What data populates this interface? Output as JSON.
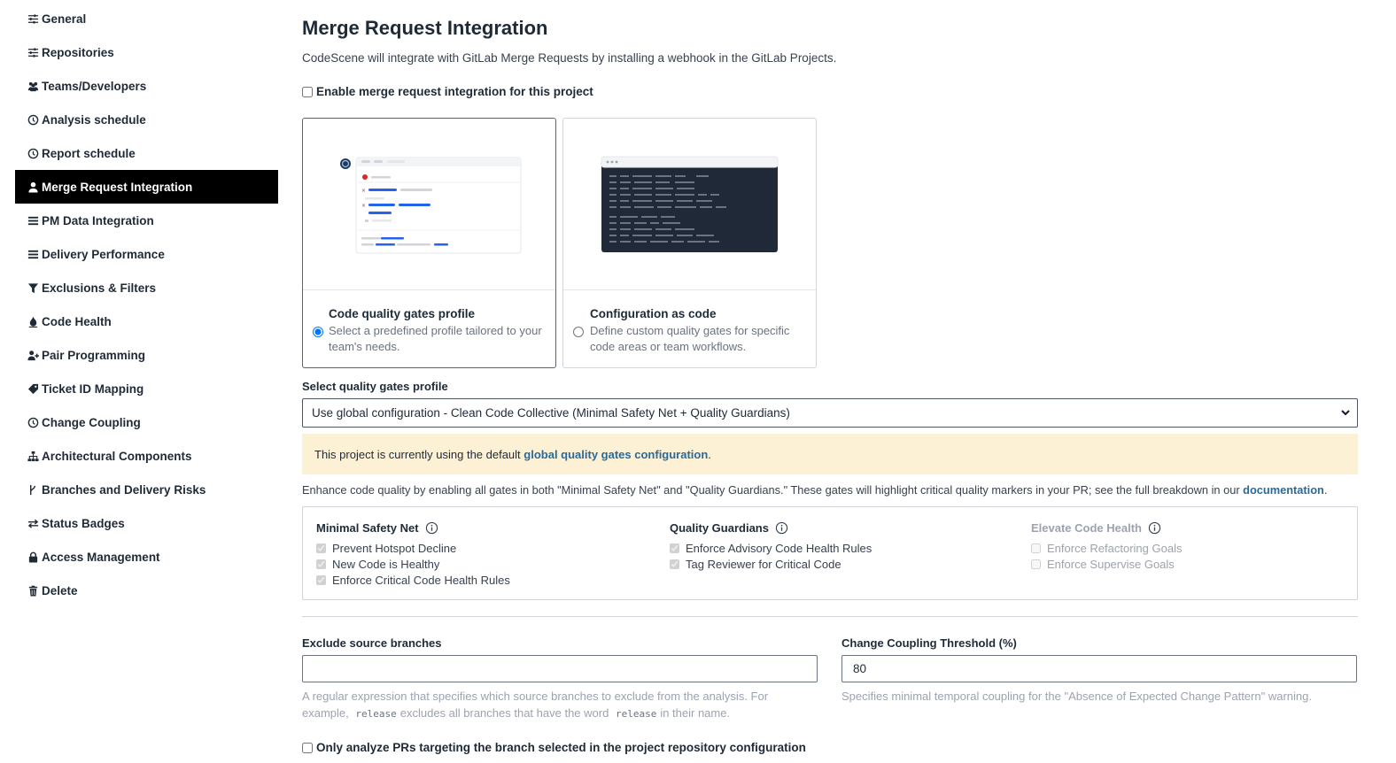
{
  "sidebar": {
    "items": [
      {
        "label": "General",
        "icon": "sliders-icon",
        "active": false
      },
      {
        "label": "Repositories",
        "icon": "sliders-icon",
        "active": false
      },
      {
        "label": "Teams/Developers",
        "icon": "users-icon",
        "active": false
      },
      {
        "label": "Analysis schedule",
        "icon": "clock-icon",
        "active": false
      },
      {
        "label": "Report schedule",
        "icon": "clock-icon",
        "active": false
      },
      {
        "label": "Merge Request Integration",
        "icon": "user-icon",
        "active": true
      },
      {
        "label": "PM Data Integration",
        "icon": "list-icon",
        "active": false
      },
      {
        "label": "Delivery Performance",
        "icon": "list-icon",
        "active": false
      },
      {
        "label": "Exclusions & Filters",
        "icon": "filter-icon",
        "active": false
      },
      {
        "label": "Code Health",
        "icon": "fire-icon",
        "active": false
      },
      {
        "label": "Pair Programming",
        "icon": "user-plus-icon",
        "active": false
      },
      {
        "label": "Ticket ID Mapping",
        "icon": "tag-icon",
        "active": false
      },
      {
        "label": "Change Coupling",
        "icon": "clock-icon",
        "active": false
      },
      {
        "label": "Architectural Components",
        "icon": "sitemap-icon",
        "active": false
      },
      {
        "label": "Branches and Delivery Risks",
        "icon": "branch-icon",
        "active": false
      },
      {
        "label": "Status Badges",
        "icon": "exchange-icon",
        "active": false
      },
      {
        "label": "Access Management",
        "icon": "lock-icon",
        "active": false
      },
      {
        "label": "Delete",
        "icon": "trash-icon",
        "active": false
      }
    ]
  },
  "main": {
    "title": "Merge Request Integration",
    "subtitle": "CodeScene will integrate with GitLab Merge Requests by installing a webhook in the GitLab Projects.",
    "enable_label": "Enable merge request integration for this project",
    "enable_checked": false,
    "cards": [
      {
        "title": "Code quality gates profile",
        "desc": "Select a predefined profile tailored to your team's needs.",
        "selected": true
      },
      {
        "title": "Configuration as code",
        "desc": "Define custom quality gates for specific code areas or team workflows.",
        "selected": false
      }
    ],
    "profile_label": "Select quality gates profile",
    "profile_selected": "Use global configuration - Clean Code Collective (Minimal Safety Net + Quality Guardians)",
    "banner": {
      "prefix": "This project is currently using the default ",
      "link": "global quality gates configuration",
      "suffix": "."
    },
    "enhance": {
      "text": "Enhance code quality by enabling all gates in both \"Minimal Safety Net\" and \"Quality Guardians.\" These gates will highlight critical quality markers in your PR; see the full breakdown in our ",
      "link": "documentation",
      "suffix": "."
    },
    "gates": [
      {
        "title": "Minimal Safety Net",
        "disabled": false,
        "items": [
          {
            "label": "Prevent Hotspot Decline",
            "checked": true
          },
          {
            "label": "New Code is Healthy",
            "checked": true
          },
          {
            "label": "Enforce Critical Code Health Rules",
            "checked": true
          }
        ]
      },
      {
        "title": "Quality Guardians",
        "disabled": false,
        "items": [
          {
            "label": "Enforce Advisory Code Health Rules",
            "checked": true
          },
          {
            "label": "Tag Reviewer for Critical Code",
            "checked": true
          }
        ]
      },
      {
        "title": "Elevate Code Health",
        "disabled": true,
        "items": [
          {
            "label": "Enforce Refactoring Goals",
            "checked": false
          },
          {
            "label": "Enforce Supervise Goals",
            "checked": false
          }
        ]
      }
    ],
    "exclude": {
      "label": "Exclude source branches",
      "value": "",
      "help_1": "A regular expression that specifies which source branches to exclude from the analysis. For",
      "help_2a": "example,",
      "help_code1": "release",
      "help_2b": "excludes all branches that have the word",
      "help_code2": "release",
      "help_2c": "in their name."
    },
    "coupling": {
      "label": "Change Coupling Threshold (%)",
      "value": "80",
      "help": "Specifies minimal temporal coupling for the \"Absence of Expected Change Pattern\" warning."
    },
    "only_analyze_label": "Only analyze PRs targeting the branch selected in the project repository configuration",
    "only_analyze_checked": false
  }
}
